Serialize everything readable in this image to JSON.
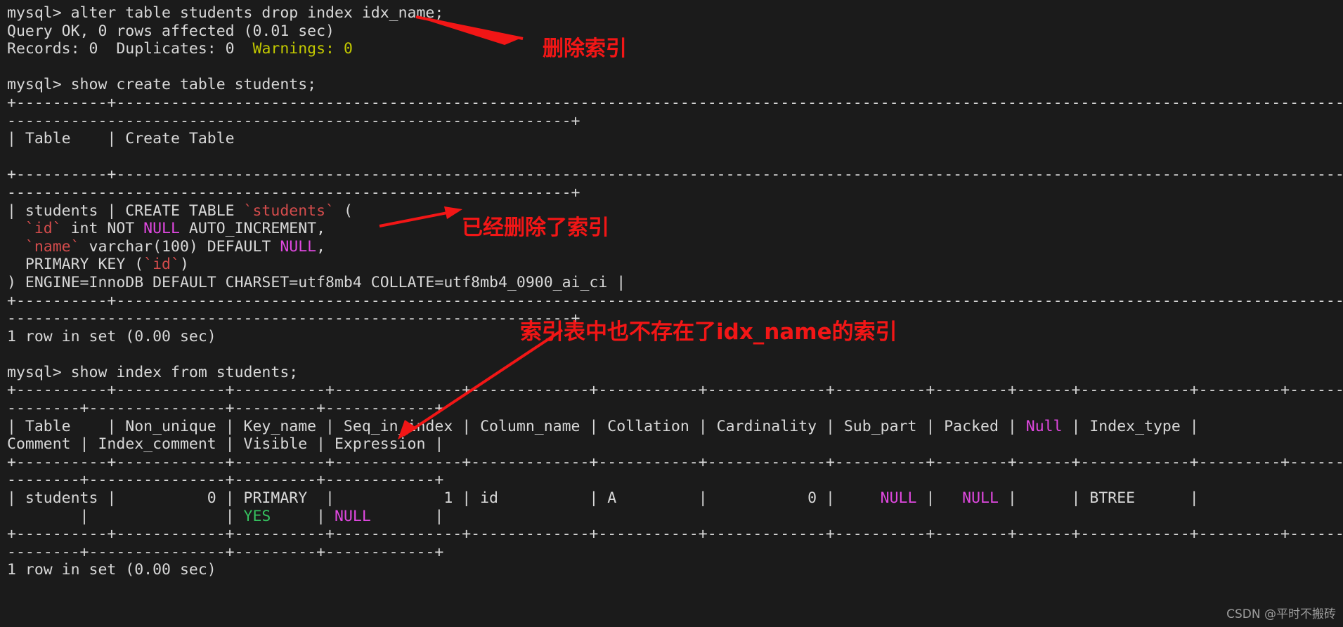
{
  "terminal": {
    "title": "mysql client session",
    "background_color": "#1b1b1b",
    "foreground_color": "#d8d8d8",
    "prompt": "mysql>",
    "lines": [
      {
        "id": "l01",
        "text": "mysql> alter table students drop index idx_name;"
      },
      {
        "id": "l02",
        "text": "Query OK, 0 rows affected (0.01 sec)"
      },
      {
        "id": "l03a",
        "text": "Records: 0  Duplicates: 0  "
      },
      {
        "id": "l03b",
        "text": "Warnings: 0"
      },
      {
        "id": "l04",
        "text": ""
      },
      {
        "id": "l05",
        "text": "mysql> show create table students;"
      },
      {
        "id": "l06",
        "text": "+----------+-------------------------------------------------------------------------------------------------------------------------------------------------------------------------------------------------------------------------"
      },
      {
        "id": "l07",
        "text": "--------------------------------------------------------------+"
      },
      {
        "id": "l08",
        "text": "| Table    | Create Table"
      },
      {
        "id": "l09",
        "text": "                                                                                                                                                                                        |"
      },
      {
        "id": "l10",
        "text": "+----------+-------------------------------------------------------------------------------------------------------------------------------------------------------------------------------------------------------------------------"
      },
      {
        "id": "l11",
        "text": "--------------------------------------------------------------+"
      },
      {
        "id": "l12",
        "text": "| students | CREATE TABLE `students` ("
      },
      {
        "id": "l13",
        "text": "  `id` int NOT NULL AUTO_INCREMENT,"
      },
      {
        "id": "l14",
        "text": "  `name` varchar(100) DEFAULT NULL,"
      },
      {
        "id": "l15",
        "text": "  PRIMARY KEY (`id`)"
      },
      {
        "id": "l16",
        "text": ") ENGINE=InnoDB DEFAULT CHARSET=utf8mb4 COLLATE=utf8mb4_0900_ai_ci |"
      },
      {
        "id": "l17",
        "text": "+----------+-------------------------------------------------------------------------------------------------------------------------------------------------------------------------------------------------------------------------"
      },
      {
        "id": "l18",
        "text": "--------------------------------------------------------------+"
      },
      {
        "id": "l19",
        "text": "1 row in set (0.00 sec)"
      },
      {
        "id": "l20",
        "text": ""
      },
      {
        "id": "l21",
        "text": "mysql> show index from students;"
      },
      {
        "id": "l22",
        "text": "+----------+------------+----------+--------------+-------------+-----------+-------------+----------+--------+------+------------+---------+---------------+---------+------------+"
      },
      {
        "id": "l23",
        "text": "--------+---------------+---------+------------+"
      },
      {
        "id": "l24",
        "text": "| Table    | Non_unique | Key_name | Seq_in_index | Column_name | Collation | Cardinality | Sub_part | Packed | Null | Index_type |"
      },
      {
        "id": "l25",
        "text": "Comment | Index_comment | Visible | Expression |"
      },
      {
        "id": "l26",
        "text": "+----------+------------+----------+--------------+-------------+-----------+-------------+----------+--------+------+------------+---------+---------------+---------+------------+"
      },
      {
        "id": "l27",
        "text": "--------+---------------+---------+------------+"
      },
      {
        "id": "l28",
        "text": "| students |          0 | PRIMARY  |            1 | id          | A         |           0 |     NULL |   NULL |      | BTREE      |"
      },
      {
        "id": "l29",
        "text": "        |               | YES     | NULL       |"
      },
      {
        "id": "l30",
        "text": "+----------+------------+----------+--------------+-------------+-----------+-------------+----------+--------+------+------------+---------+---------------+---------+------------+"
      },
      {
        "id": "l31",
        "text": "--------+---------------+---------+------------+"
      },
      {
        "id": "l32",
        "text": "1 row in set (0.00 sec)"
      }
    ],
    "commands": [
      "alter table students drop index idx_name;",
      "show create table students;",
      "show index from students;"
    ],
    "results": {
      "alter_status": "Query OK, 0 rows affected (0.01 sec)",
      "alter_records": "Records: 0  Duplicates: 0  ",
      "alter_warnings": "Warnings: 0",
      "create_table_headers": [
        "Table",
        "Create Table"
      ],
      "create_table_row_name": "students",
      "create_table_ddl": [
        "CREATE TABLE `students` (",
        "  `id` int NOT NULL AUTO_INCREMENT,",
        "  `name` varchar(100) DEFAULT NULL,",
        "  PRIMARY KEY (`id`)",
        ") ENGINE=InnoDB DEFAULT CHARSET=utf8mb4 COLLATE=utf8mb4_0900_ai_ci |"
      ],
      "create_table_footer": "1 row in set (0.00 sec)",
      "index_headers": [
        "Table",
        "Non_unique",
        "Key_name",
        "Seq_in_index",
        "Column_name",
        "Collation",
        "Cardinality",
        "Sub_part",
        "Packed",
        "Null",
        "Index_type",
        "Comment",
        "Index_comment",
        "Visible",
        "Expression"
      ],
      "index_row": {
        "Table": "students",
        "Non_unique": "0",
        "Key_name": "PRIMARY",
        "Seq_in_index": "1",
        "Column_name": "id",
        "Collation": "A",
        "Cardinality": "0",
        "Sub_part": "NULL",
        "Packed": "NULL",
        "Null": "",
        "Index_type": "BTREE",
        "Comment": "",
        "Index_comment": "",
        "Visible": "YES",
        "Expression": "NULL"
      },
      "index_footer": "1 row in set (0.00 sec)"
    }
  },
  "annotations": {
    "color": "#f21616",
    "items": [
      {
        "id": "annot-1",
        "text": "删除索引"
      },
      {
        "id": "annot-2",
        "text": "已经删除了索引"
      },
      {
        "id": "annot-3",
        "text": "索引表中也不存在了idx_name的索引"
      }
    ]
  },
  "watermark": {
    "text": "CSDN @平时不搬砖",
    "color": "#9d9d9d"
  },
  "colors": {
    "background": "#1b1b1b",
    "foreground": "#d8d8d8",
    "keyword_null": "#e048e0",
    "identifier": "#d44c4c",
    "warning": "#c2c800",
    "yes": "#35c15f",
    "annotation_red": "#f21616"
  }
}
